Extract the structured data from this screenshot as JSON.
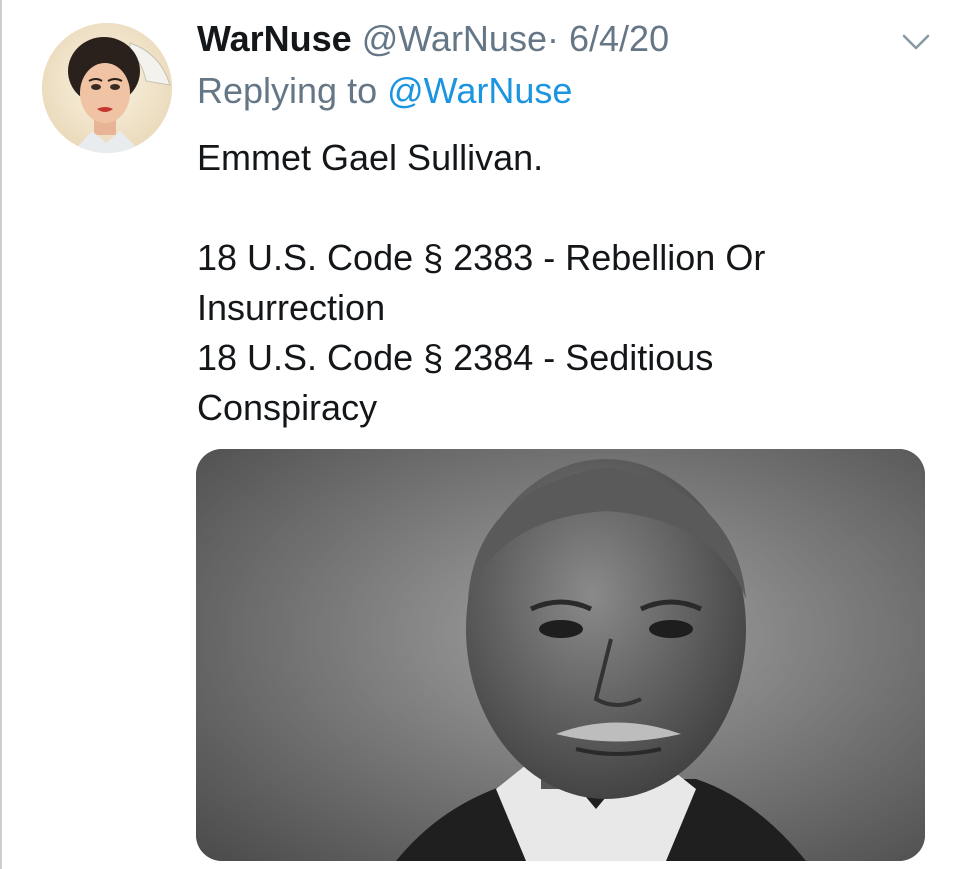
{
  "tweet": {
    "display_name": "WarNuse",
    "handle": "@WarNuse",
    "separator": "·",
    "date": "6/4/20",
    "reply_prefix": "Replying to",
    "reply_to": "@WarNuse",
    "text_lines": [
      "Emmet Gael Sullivan.",
      "",
      "18 U.S. Code § 2383 - Rebellion Or",
      "Insurrection",
      "18 U.S. Code § 2384 - Seditious",
      "Conspiracy"
    ]
  },
  "icons": {
    "menu": "chevron-down-icon"
  },
  "colors": {
    "primary_text": "#14171a",
    "secondary_text": "#657786",
    "link": "#1b95e0"
  }
}
